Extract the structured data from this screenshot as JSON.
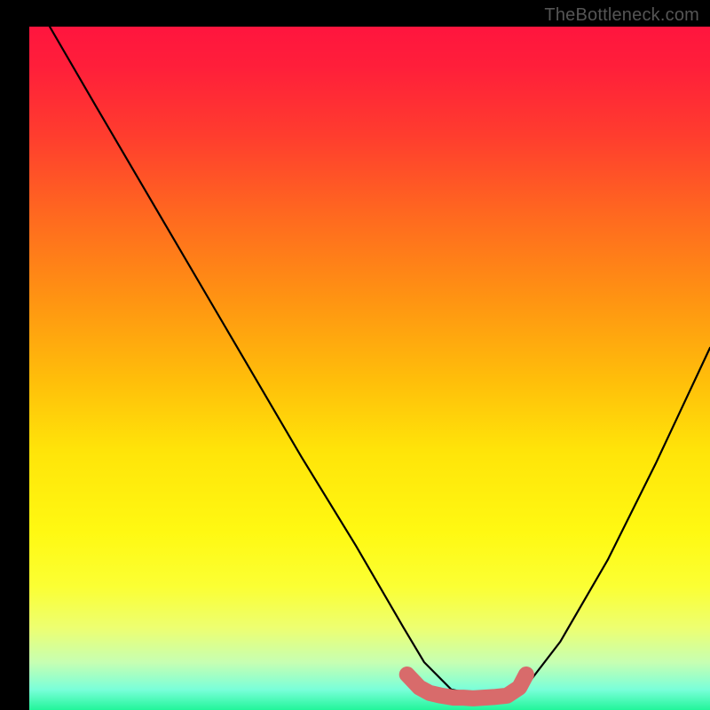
{
  "watermark": "TheBottleneck.com",
  "chart_data": {
    "type": "line",
    "title": "",
    "xlabel": "",
    "ylabel": "",
    "ylim": [
      0,
      100
    ],
    "xlim": [
      0,
      100
    ],
    "series": [
      {
        "name": "curve",
        "color": "#000000",
        "x": [
          3,
          10,
          20,
          30,
          40,
          48,
          55,
          58,
          62,
          67,
          70.5,
          73,
          78,
          85,
          92,
          100
        ],
        "y": [
          100,
          88,
          71,
          54,
          37,
          24,
          12,
          7,
          3,
          2,
          2,
          3.5,
          10,
          22,
          36,
          53
        ]
      }
    ],
    "annotations": [
      {
        "name": "bottom-marker",
        "type": "polyline",
        "color": "#d86b6b",
        "stroke_width_px": 14,
        "points_x": [
          55.5,
          57.3,
          58.8,
          60.5,
          62.3,
          63.8,
          65.2,
          66.7,
          68.2,
          70.2,
          72.0,
          73.0
        ],
        "points_y": [
          5.2,
          3.3,
          2.5,
          2.1,
          1.8,
          1.8,
          1.7,
          1.8,
          1.9,
          2.1,
          3.3,
          5.2
        ]
      }
    ],
    "gradient_stops": [
      {
        "pos": 0.0,
        "color": "#ff153e"
      },
      {
        "pos": 0.5,
        "color": "#ffbf0a"
      },
      {
        "pos": 0.82,
        "color": "#fbff34"
      },
      {
        "pos": 1.0,
        "color": "#22f59a"
      }
    ]
  }
}
